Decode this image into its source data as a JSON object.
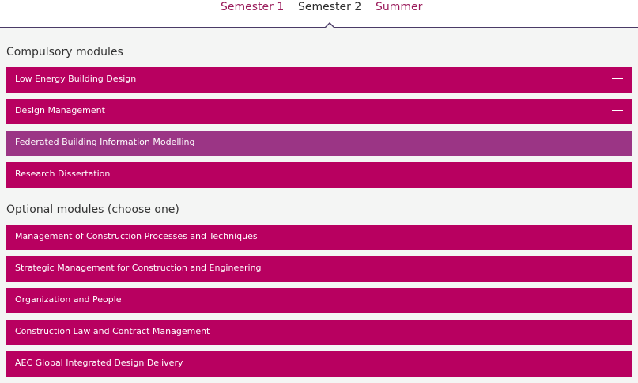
{
  "tabs": {
    "semester1": "Semester 1",
    "semester2": "Semester 2",
    "summer": "Summer",
    "active": "semester2"
  },
  "colors": {
    "module_bg": "#b80060",
    "module_hover_bg": "#9b3585",
    "tab_link": "#9b1d5c",
    "tab_rule": "#4a3a66",
    "content_bg": "#f4f5f4"
  },
  "compulsory": {
    "title": "Compulsory modules",
    "items": [
      {
        "label": "Low Energy Building Design",
        "icon": "plus-icon"
      },
      {
        "label": "Design Management",
        "icon": "plus-icon"
      },
      {
        "label": "Federated Building Information Modelling",
        "icon": "collapse-icon"
      },
      {
        "label": "Research Dissertation",
        "icon": "collapse-icon"
      }
    ]
  },
  "optional": {
    "title": "Optional modules (choose one)",
    "items": [
      {
        "label": "Management of Construction Processes and Techniques",
        "icon": "collapse-icon"
      },
      {
        "label": "Strategic Management for Construction and Engineering",
        "icon": "collapse-icon"
      },
      {
        "label": "Organization and People",
        "icon": "collapse-icon"
      },
      {
        "label": "Construction Law and Contract Management",
        "icon": "collapse-icon"
      },
      {
        "label": "AEC Global Integrated Design Delivery",
        "icon": "collapse-icon"
      }
    ]
  }
}
